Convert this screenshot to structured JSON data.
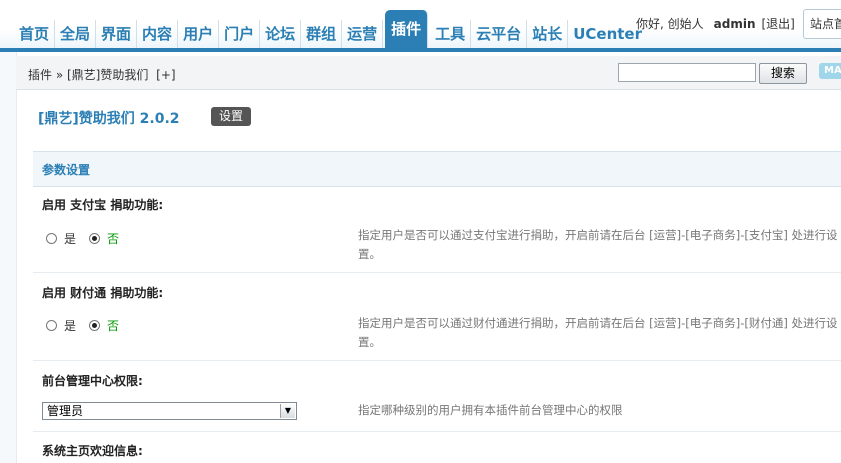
{
  "nav": {
    "items": [
      "首页",
      "全局",
      "界面",
      "内容",
      "用户",
      "门户",
      "论坛",
      "群组",
      "运营",
      "插件",
      "工具",
      "云平台",
      "站长",
      "UCenter"
    ],
    "active_index": 9
  },
  "user": {
    "greeting": "你好, 创始人",
    "name": "admin",
    "logout": "[退出]",
    "site_home": "站点首"
  },
  "breadcrumb": {
    "text": "插件 » [鼎艺]赞助我们",
    "add": "[+]"
  },
  "search": {
    "button": "搜索",
    "value": "",
    "map_label": "MA"
  },
  "page": {
    "title": "[鼎艺]赞助我们 2.0.2",
    "settings_button": "设置"
  },
  "section": {
    "title": "参数设置"
  },
  "settings": [
    {
      "label": "启用 支付宝 捐助功能:",
      "options": [
        "是",
        "否"
      ],
      "selected": "否",
      "description": "指定用户是否可以通过支付宝进行捐助，开启前请在后台 [运营]-[电子商务]-[支付宝] 处进行设置。"
    },
    {
      "label": "启用 财付通 捐助功能:",
      "options": [
        "是",
        "否"
      ],
      "selected": "否",
      "description": "指定用户是否可以通过财付通进行捐助，开启前请在后台 [运营]-[电子商务]-[财付通] 处进行设置。"
    },
    {
      "label": "前台管理中心权限:",
      "select_value": "管理员",
      "description": "指定哪种级别的用户拥有本插件前台管理中心的权限"
    },
    {
      "label": "系统主页欢迎信息:"
    }
  ],
  "colors": {
    "accent": "#2b7fb4",
    "selected_text": "#009900",
    "section_bg": "#f0f6fa",
    "button_dark": "#555555"
  }
}
